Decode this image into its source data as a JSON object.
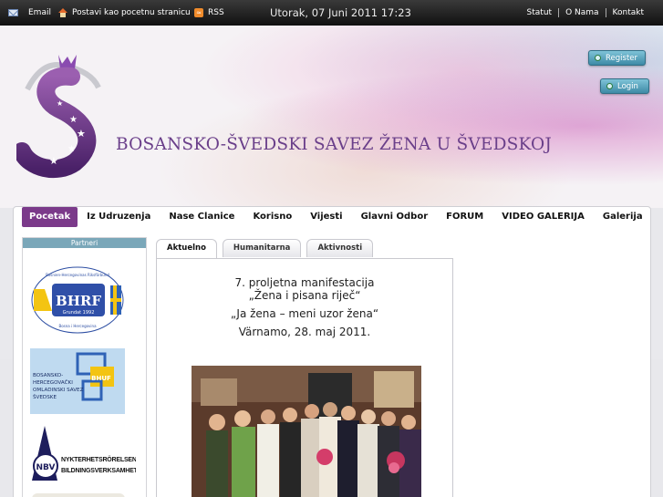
{
  "topbar": {
    "email_label": "Email",
    "homepage_label": "Postavi kao pocetnu stranicu",
    "rss_label": "RSS",
    "date": "Utorak, 07 Juni 2011 17:23",
    "links": [
      "Statut",
      "O Nama",
      "Kontakt"
    ]
  },
  "header": {
    "title": "BOSANSKO-ŠVEDSKI SAVEZ ŽENA U ŠVEDSKOJ",
    "register_label": "Register",
    "login_label": "Login"
  },
  "nav": {
    "items": [
      "Pocetak",
      "Iz Udruzenja",
      "Nase Clanice",
      "Korisno",
      "Vijesti",
      "Glavni Odbor",
      "FORUM",
      "VIDEO GALERIJA",
      "Galerija"
    ],
    "active": "Pocetak"
  },
  "sidebar": {
    "title": "Partneri",
    "partners": [
      {
        "logo_text": "BHRF",
        "sub_text": "Grundat 1992",
        "ring_text_top": "Bosnien-Hercegovinas Riksförbund",
        "ring_text_bottom": "Bosna i Hercegovina"
      },
      {
        "logo_text": "BHUF",
        "sub_text": "BOSANSKO-HERCEGOVAČKI OMLADINSKI SAVEZ ŠVEDSKE"
      },
      {
        "logo_text": "NBV",
        "sub_text": "NYKTERHETSRÖRELSENS BILDNINGSVERKSAMHET"
      }
    ]
  },
  "tabs": [
    "Aktuelno",
    "Humanitarna",
    "Aktivnosti"
  ],
  "article": {
    "line1": "7. proljetna manifestacija",
    "line2": "„Žena i pisana riječ“",
    "line3": "„Ja žena – meni uzor žena“",
    "line4": "Värnamo, 28. maj 2011."
  },
  "colors": {
    "accent_purple": "#7b3a8a",
    "title_purple": "#6a3f8a",
    "button_teal": "#3d8aa6"
  }
}
